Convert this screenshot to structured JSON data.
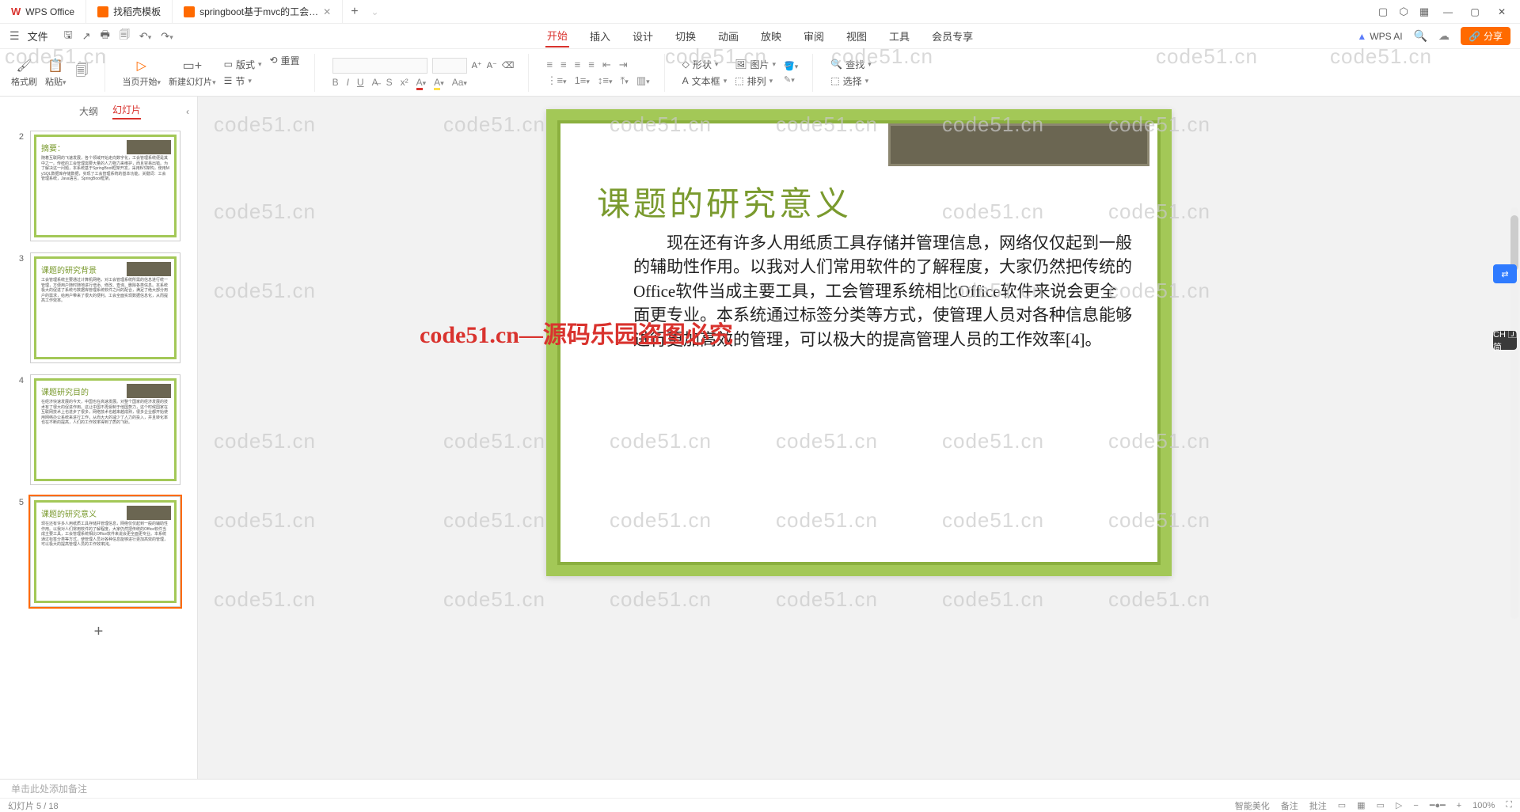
{
  "titlebar": {
    "tabs": [
      {
        "label": "WPS Office",
        "icon": "wps"
      },
      {
        "label": "找稻壳模板",
        "icon": "template"
      },
      {
        "label": "springboot基于mvc的工会…",
        "icon": "doc",
        "closable": true
      }
    ]
  },
  "menubar": {
    "file": "文件",
    "tabs": [
      "开始",
      "插入",
      "设计",
      "切换",
      "动画",
      "放映",
      "审阅",
      "视图",
      "工具",
      "会员专享"
    ],
    "active": "开始",
    "wps_ai": "WPS AI",
    "share": "分享"
  },
  "ribbon": {
    "format_painter": "格式刷",
    "paste": "粘贴",
    "start_page": "当页开始",
    "new_slide": "新建幻灯片",
    "layout": "版式",
    "section": "节",
    "reset": "重置",
    "shape": "形状",
    "image": "图片",
    "textbox": "文本框",
    "arrange": "排列",
    "find": "查找",
    "select": "选择"
  },
  "panel": {
    "outline": "大纲",
    "slides": "幻灯片",
    "thumbs": [
      {
        "num": "2",
        "title": "摘要：",
        "text": "随着互联网的飞速发展，各个领域开始走向数字化，工会管理系统便是其中之一。传统的工会管理需要大量的人力物力来维护，而且容易出错。为了解决这一问题，本系统基于SpringBoot框架开发，采用B/S架构，使用MySQL数据库存储数据，实现了工会管理系统的基本功能。关键词：工会管理系统，Java语言，SpringBoot框架。"
      },
      {
        "num": "3",
        "title": "课题的研究背景",
        "text": "工会管理系统主要通过计算机网络，对工会管理系统所需的信息进行统一管理，方便用户随时随地进行增添、修改、查询、删除各类信息。本系统极大的促进了系统与数据库管理系统软件之间的配合，满足了绝大部分用户的需求，给用户带来了很大的便利。工会全面实现数据信息化，从而提高工作效率。"
      },
      {
        "num": "4",
        "title": "课题研究目的",
        "text": "在经济快速发展的今天，中国也在高速发展。对整个国家的经济发展的技术有了很大的促进作用。这让中国不再受制于他国势力，这个时候国家在互联网技术上也进步了很多，网络技术也越来越成熟，很多企业都开始使用网络办公系统来进行工作，从而大大的减少了人力的投入，并且转化率也在不断的提高，人们的工作效率得到了质的飞跃。"
      },
      {
        "num": "5",
        "title": "课题的研究意义",
        "text": "现在还有许多人用纸质工具存储并管理信息，网络仅仅起到一般的辅助性作用。以我对人们常用软件的了解程度，大家仍然把传统的Office软件当成主要工具，工会管理系统相比Office软件来说会更全面更专业。本系统通过标签分类等方式，使管理人员对各种信息能够进行更加高效的管理，可以极大的提高管理人员的工作效率[4]。"
      }
    ]
  },
  "slide": {
    "title": "课题的研究意义",
    "body": "现在还有许多人用纸质工具存储并管理信息，网络仅仅起到一般的辅助性作用。以我对人们常用软件的了解程度，大家仍然把传统的Office软件当成主要工具，工会管理系统相比Office软件来说会更全面更专业。本系统通过标签分类等方式，使管理人员对各种信息能够进行更加高效的管理，可以极大的提高管理人员的工作效率[4]。"
  },
  "notes": {
    "placeholder": "单击此处添加备注"
  },
  "watermark": {
    "text": "code51.cn",
    "red_text": "code51.cn—源码乐园盗图必究"
  },
  "float": {
    "ime": "CH 🄹 简"
  },
  "statusbar": {
    "left": "幻灯片 5 / 18",
    "items": [
      "智能美化",
      "备注",
      "批注"
    ],
    "zoom": "100%"
  }
}
